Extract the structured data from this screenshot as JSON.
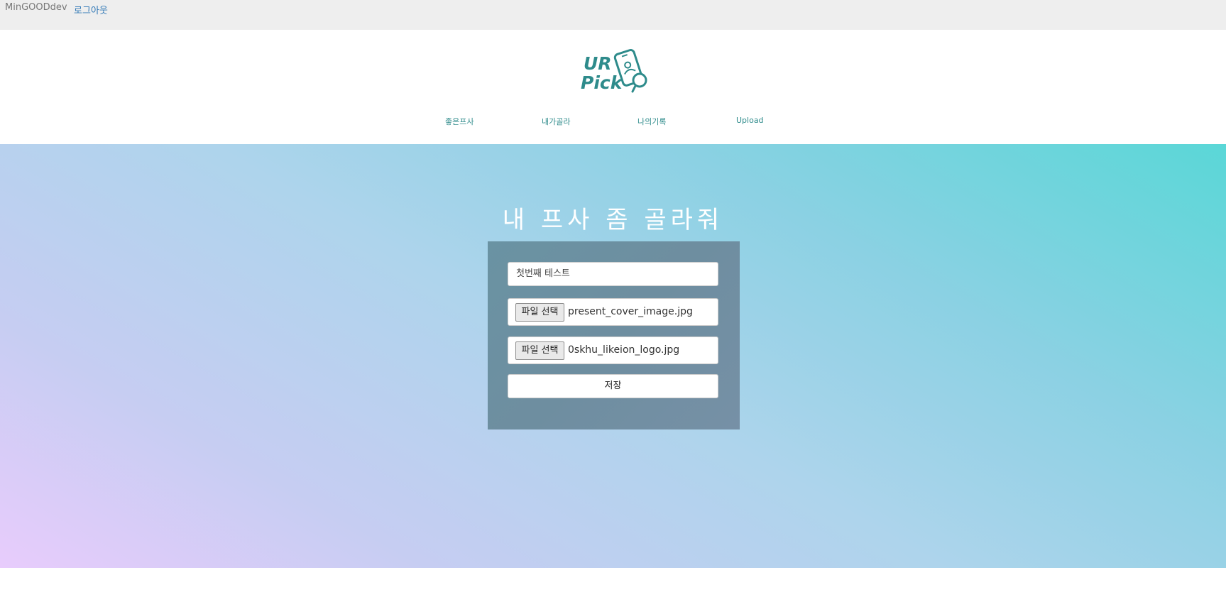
{
  "topbar": {
    "username": "MinGOODdev",
    "logout_label": "로그아웃"
  },
  "header": {
    "logo_text_line1": "UR",
    "logo_text_line2": "Pick",
    "nav": [
      {
        "label": "좋은프사"
      },
      {
        "label": "내가골라"
      },
      {
        "label": "나의기록"
      },
      {
        "label": "Upload"
      }
    ]
  },
  "hero": {
    "title": "내 프사 좀 골라줘"
  },
  "form": {
    "title_value": "첫번째 테스트",
    "file1": {
      "button_label": "파일 선택",
      "file_name": "present_cover_image.jpg"
    },
    "file2": {
      "button_label": "파일 선택",
      "file_name": "0skhu_likeion_logo.jpg"
    },
    "save_label": "저장"
  },
  "colors": {
    "brand": "#2e8b8b",
    "link": "#337ab7",
    "topbar_bg": "#eeeeee"
  }
}
